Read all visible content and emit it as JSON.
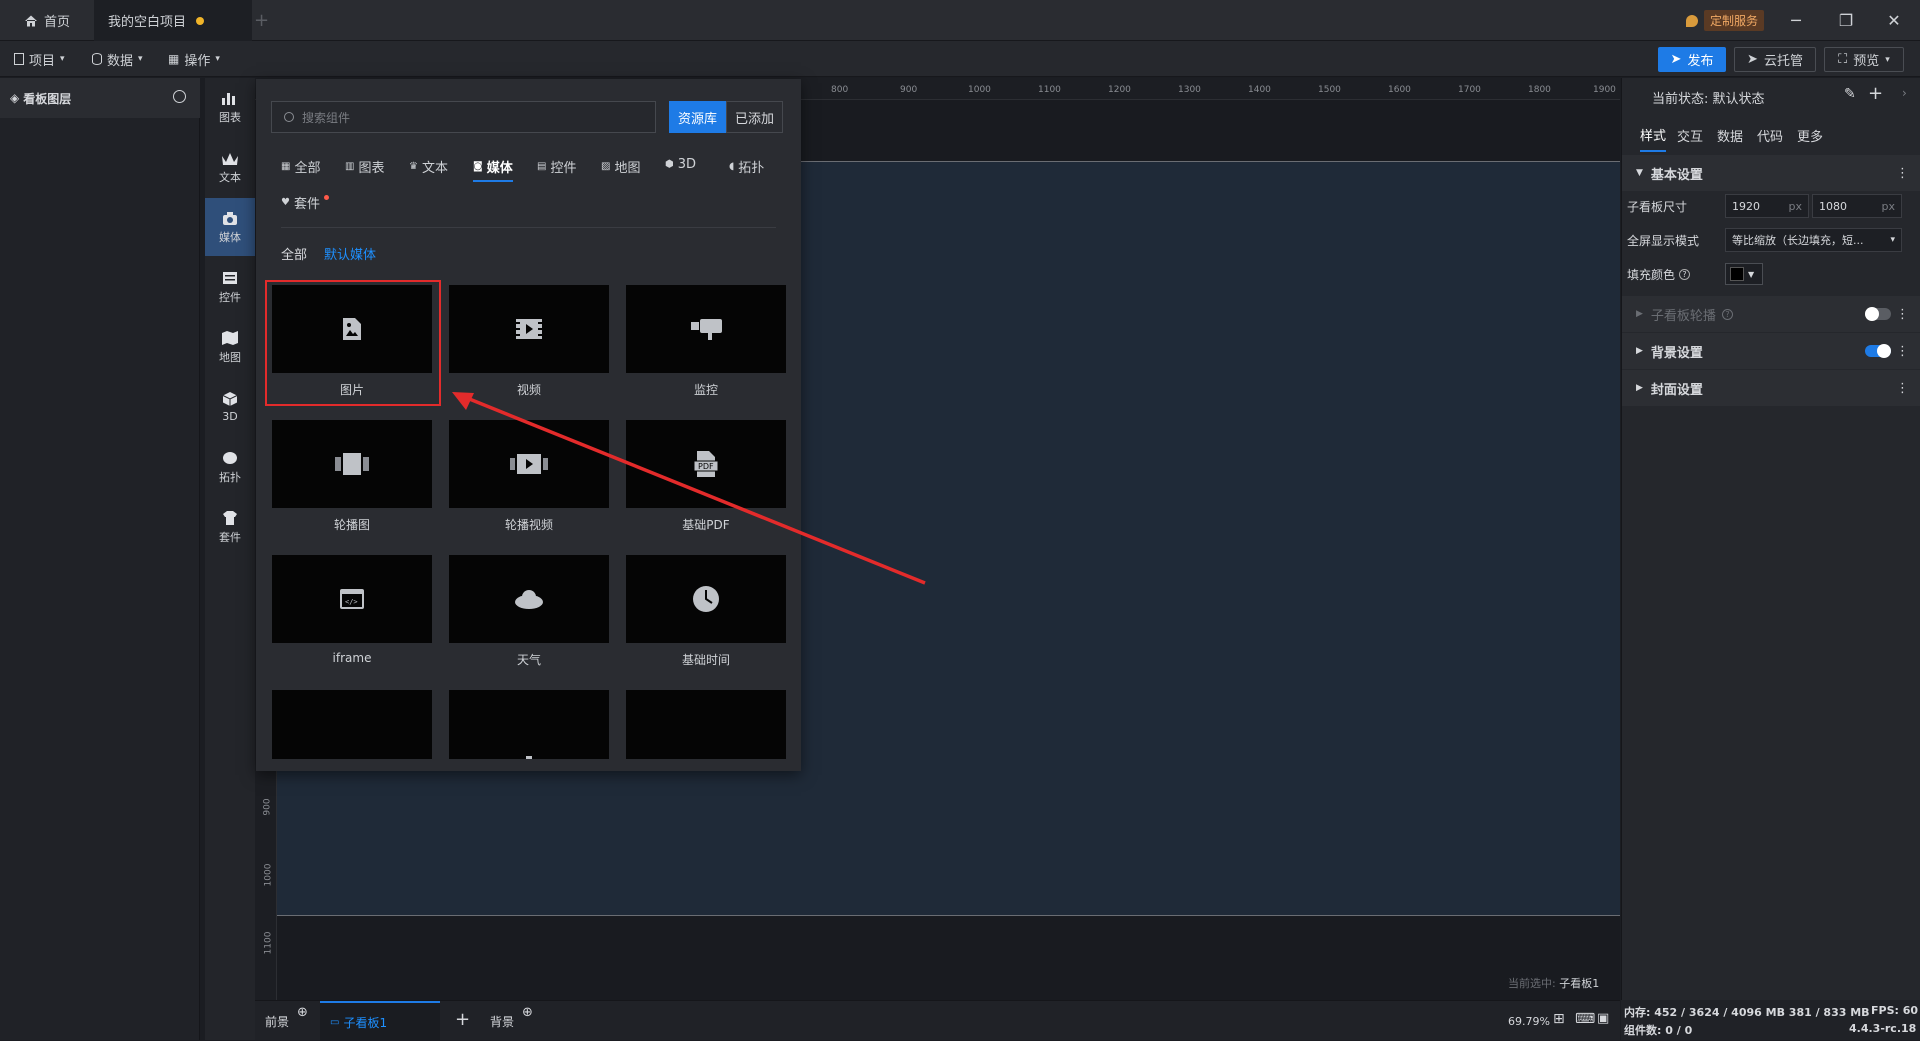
{
  "titlebar": {
    "tabs": [
      {
        "label": "首页"
      },
      {
        "label": "我的空白项目"
      }
    ],
    "add_tab": "+",
    "custom_service": "定制服务"
  },
  "toolbar": {
    "menus": [
      "项目",
      "数据",
      "操作"
    ],
    "publish": "发布",
    "cloud_host": "云托管",
    "preview": "预览"
  },
  "layer_panel": {
    "title": "看板图层"
  },
  "rail": {
    "items": [
      {
        "label": "图表",
        "icon": "chart-icon"
      },
      {
        "label": "文本",
        "icon": "text-icon"
      },
      {
        "label": "媒体",
        "icon": "media-icon"
      },
      {
        "label": "控件",
        "icon": "control-icon"
      },
      {
        "label": "地图",
        "icon": "map-icon"
      },
      {
        "label": "3D",
        "icon": "cube-icon"
      },
      {
        "label": "拓扑",
        "icon": "topology-icon"
      },
      {
        "label": "套件",
        "icon": "kit-icon"
      }
    ],
    "active": "媒体"
  },
  "popup": {
    "search_placeholder": "搜索组件",
    "btn_library": "资源库",
    "btn_added": "已添加",
    "categories": [
      "全部",
      "图表",
      "文本",
      "媒体",
      "控件",
      "地图",
      "3D",
      "拓扑",
      "套件"
    ],
    "active_category": "媒体",
    "subtabs": [
      "全部",
      "默认媒体"
    ],
    "active_subtab": "默认媒体",
    "components": [
      {
        "label": "图片",
        "icon": "image-icon"
      },
      {
        "label": "视频",
        "icon": "video-icon"
      },
      {
        "label": "监控",
        "icon": "camera-icon"
      },
      {
        "label": "轮播图",
        "icon": "carousel-icon"
      },
      {
        "label": "轮播视频",
        "icon": "carousel-video-icon"
      },
      {
        "label": "基础PDF",
        "icon": "pdf-icon"
      },
      {
        "label": "iframe",
        "icon": "iframe-icon"
      },
      {
        "label": "天气",
        "icon": "cloud-icon"
      },
      {
        "label": "基础时间",
        "icon": "clock-icon"
      }
    ]
  },
  "ruler": {
    "top": [
      "800",
      "900",
      "1000",
      "1100",
      "1200",
      "1300",
      "1400",
      "1500",
      "1600",
      "1700",
      "1800",
      "1900"
    ],
    "left": [
      "900",
      "1000",
      "1100"
    ]
  },
  "canvas": {
    "selected_prefix": "当前选中:",
    "selected_name": "子看板1"
  },
  "right_panel": {
    "state_label": "当前状态:",
    "state_value": "默认状态",
    "tabs": [
      "样式",
      "交互",
      "数据",
      "代码",
      "更多"
    ],
    "active_tab": "样式",
    "basic_settings": "基本设置",
    "size_label": "子看板尺寸",
    "width": "1920",
    "height": "1080",
    "unit": "px",
    "fullscreen_label": "全屏显示模式",
    "fullscreen_value": "等比缩放（长边填充，短...",
    "fill_label": "填充颜色",
    "fill_color": "#000000",
    "carousel_label": "子看板轮播",
    "carousel_on": false,
    "background_label": "背景设置",
    "background_on": true,
    "cover_label": "封面设置"
  },
  "bottom": {
    "foreground": "前景",
    "board_tab": "子看板1",
    "background": "背景",
    "zoom": "69.79%"
  },
  "status": {
    "memory_label": "内存:",
    "memory_value": "452 / 3624 / 4096 MB  381 / 833 MB",
    "fps_label": "FPS:",
    "fps_value": "60",
    "components_label": "组件数:",
    "components_value": "0 / 0",
    "version": "4.4.3-rc.18"
  },
  "colors": {
    "accent": "#1e7be6",
    "highlight_box": "#e32b2b",
    "arrow": "#e32b2b"
  }
}
